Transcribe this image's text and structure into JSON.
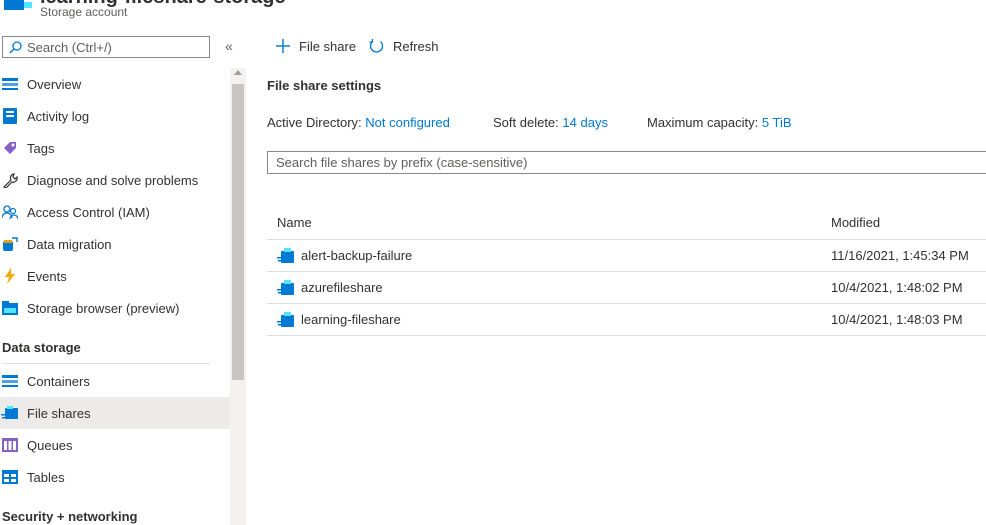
{
  "header": {
    "title": "learning-fileshare-storage",
    "subtitle": "Storage account"
  },
  "search": {
    "placeholder": "Search (Ctrl+/)"
  },
  "sidebar": {
    "items": [
      {
        "label": "Overview",
        "icon": "overview-icon"
      },
      {
        "label": "Activity log",
        "icon": "activity-log-icon"
      },
      {
        "label": "Tags",
        "icon": "tag-icon"
      },
      {
        "label": "Diagnose and solve problems",
        "icon": "wrench-icon"
      },
      {
        "label": "Access Control (IAM)",
        "icon": "people-icon"
      },
      {
        "label": "Data migration",
        "icon": "data-migration-icon"
      },
      {
        "label": "Events",
        "icon": "lightning-icon"
      },
      {
        "label": "Storage browser (preview)",
        "icon": "storage-browser-icon"
      }
    ],
    "section_data_storage": "Data storage",
    "data_storage_items": [
      {
        "label": "Containers",
        "icon": "containers-icon"
      },
      {
        "label": "File shares",
        "icon": "file-share-icon",
        "active": true
      },
      {
        "label": "Queues",
        "icon": "queues-icon"
      },
      {
        "label": "Tables",
        "icon": "tables-icon"
      }
    ],
    "section_security": "Security + networking"
  },
  "toolbar": {
    "add_label": "File share",
    "refresh_label": "Refresh"
  },
  "settings": {
    "title": "File share settings",
    "ad_label": "Active Directory:",
    "ad_value": "Not configured",
    "soft_delete_label": "Soft delete:",
    "soft_delete_value": "14 days",
    "max_cap_label": "Maximum capacity:",
    "max_cap_value": "5 TiB"
  },
  "filter": {
    "placeholder": "Search file shares by prefix (case-sensitive)"
  },
  "table": {
    "columns": [
      "Name",
      "Modified"
    ],
    "rows": [
      {
        "name": "alert-backup-failure",
        "modified": "11/16/2021, 1:45:34 PM"
      },
      {
        "name": "azurefileshare",
        "modified": "10/4/2021, 1:48:02 PM"
      },
      {
        "name": "learning-fileshare",
        "modified": "10/4/2021, 1:48:03 PM"
      }
    ]
  },
  "colors": {
    "accent": "#0078d4",
    "active_bg": "#edebe9",
    "border": "#8a8886"
  }
}
